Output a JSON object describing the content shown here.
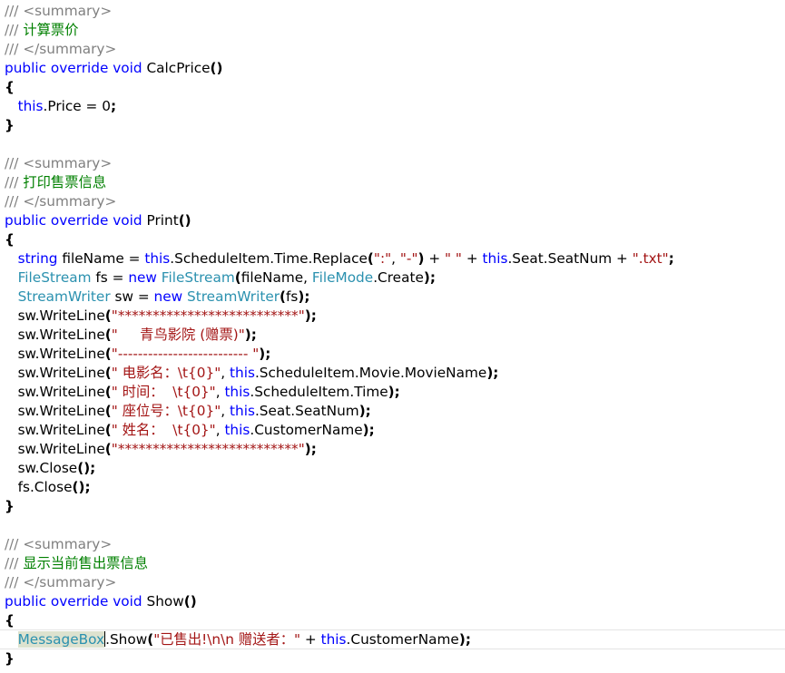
{
  "editor": {
    "current_line": 33,
    "lines": [
      [
        [
          "g",
          "/// <summary>"
        ]
      ],
      [
        [
          "g",
          "/// "
        ],
        [
          "cm",
          "计算票价"
        ]
      ],
      [
        [
          "g",
          "/// </summary>"
        ]
      ],
      [
        [
          "k",
          "public override void "
        ],
        [
          "p",
          "CalcPrice"
        ],
        [
          "b",
          "()"
        ]
      ],
      [
        [
          "b",
          "{"
        ]
      ],
      [
        [
          "p",
          "   "
        ],
        [
          "k",
          "this"
        ],
        [
          "p",
          ".Price = 0"
        ],
        [
          "b",
          ";"
        ]
      ],
      [
        [
          "b",
          "}"
        ]
      ],
      [],
      [
        [
          "g",
          "/// <summary>"
        ]
      ],
      [
        [
          "g",
          "/// "
        ],
        [
          "cm",
          "打印售票信息"
        ]
      ],
      [
        [
          "g",
          "/// </summary>"
        ]
      ],
      [
        [
          "k",
          "public override void "
        ],
        [
          "p",
          "Print"
        ],
        [
          "b",
          "()"
        ]
      ],
      [
        [
          "b",
          "{"
        ]
      ],
      [
        [
          "p",
          "   "
        ],
        [
          "k",
          "string "
        ],
        [
          "p",
          "fileName = "
        ],
        [
          "k",
          "this"
        ],
        [
          "p",
          ".ScheduleItem.Time.Replace"
        ],
        [
          "b",
          "("
        ],
        [
          "s",
          "\":\""
        ],
        [
          "p",
          ", "
        ],
        [
          "s",
          "\"-\""
        ],
        [
          "b",
          ")"
        ],
        [
          "p",
          " + "
        ],
        [
          "s",
          "\" \""
        ],
        [
          "p",
          " + "
        ],
        [
          "k",
          "this"
        ],
        [
          "p",
          ".Seat.SeatNum + "
        ],
        [
          "s",
          "\".txt\""
        ],
        [
          "b",
          ";"
        ]
      ],
      [
        [
          "p",
          "   "
        ],
        [
          "ty",
          "FileStream "
        ],
        [
          "p",
          "fs = "
        ],
        [
          "k",
          "new "
        ],
        [
          "ty",
          "FileStream"
        ],
        [
          "b",
          "("
        ],
        [
          "p",
          "fileName, "
        ],
        [
          "ty",
          "FileMode"
        ],
        [
          "p",
          ".Create"
        ],
        [
          "b",
          ");"
        ]
      ],
      [
        [
          "p",
          "   "
        ],
        [
          "ty",
          "StreamWriter "
        ],
        [
          "p",
          "sw = "
        ],
        [
          "k",
          "new "
        ],
        [
          "ty",
          "StreamWriter"
        ],
        [
          "b",
          "("
        ],
        [
          "p",
          "fs"
        ],
        [
          "b",
          ");"
        ]
      ],
      [
        [
          "p",
          "   sw.WriteLine"
        ],
        [
          "b",
          "("
        ],
        [
          "s",
          "\"**************************\""
        ],
        [
          "b",
          ");"
        ]
      ],
      [
        [
          "p",
          "   sw.WriteLine"
        ],
        [
          "b",
          "("
        ],
        [
          "s",
          "\"     青鸟影院 (赠票)\""
        ],
        [
          "b",
          ");"
        ]
      ],
      [
        [
          "p",
          "   sw.WriteLine"
        ],
        [
          "b",
          "("
        ],
        [
          "s",
          "\"-------------------------- \""
        ],
        [
          "b",
          ");"
        ]
      ],
      [
        [
          "p",
          "   sw.WriteLine"
        ],
        [
          "b",
          "("
        ],
        [
          "s",
          "\" 电影名：\\t{0}\""
        ],
        [
          "p",
          ", "
        ],
        [
          "k",
          "this"
        ],
        [
          "p",
          ".ScheduleItem.Movie.MovieName"
        ],
        [
          "b",
          ");"
        ]
      ],
      [
        [
          "p",
          "   sw.WriteLine"
        ],
        [
          "b",
          "("
        ],
        [
          "s",
          "\" 时间：  \\t{0}\""
        ],
        [
          "p",
          ", "
        ],
        [
          "k",
          "this"
        ],
        [
          "p",
          ".ScheduleItem.Time"
        ],
        [
          "b",
          ");"
        ]
      ],
      [
        [
          "p",
          "   sw.WriteLine"
        ],
        [
          "b",
          "("
        ],
        [
          "s",
          "\" 座位号：\\t{0}\""
        ],
        [
          "p",
          ", "
        ],
        [
          "k",
          "this"
        ],
        [
          "p",
          ".Seat.SeatNum"
        ],
        [
          "b",
          ");"
        ]
      ],
      [
        [
          "p",
          "   sw.WriteLine"
        ],
        [
          "b",
          "("
        ],
        [
          "s",
          "\" 姓名：  \\t{0}\""
        ],
        [
          "p",
          ", "
        ],
        [
          "k",
          "this"
        ],
        [
          "p",
          ".CustomerName"
        ],
        [
          "b",
          ");"
        ]
      ],
      [
        [
          "p",
          "   sw.WriteLine"
        ],
        [
          "b",
          "("
        ],
        [
          "s",
          "\"**************************\""
        ],
        [
          "b",
          ");"
        ]
      ],
      [
        [
          "p",
          "   sw.Close"
        ],
        [
          "b",
          "();"
        ]
      ],
      [
        [
          "p",
          "   fs.Close"
        ],
        [
          "b",
          "();"
        ]
      ],
      [
        [
          "b",
          "}"
        ]
      ],
      [],
      [
        [
          "g",
          "/// <summary>"
        ]
      ],
      [
        [
          "g",
          "/// "
        ],
        [
          "cm",
          "显示当前售出票信息"
        ]
      ],
      [
        [
          "g",
          "/// </summary>"
        ]
      ],
      [
        [
          "k",
          "public override void "
        ],
        [
          "p",
          "Show"
        ],
        [
          "b",
          "()"
        ]
      ],
      [
        [
          "b",
          "{"
        ]
      ],
      [
        [
          "p",
          "   "
        ],
        [
          "ty hl",
          "MessageBox"
        ],
        [
          "caret",
          ""
        ],
        [
          "p",
          ".Show"
        ],
        [
          "b",
          "("
        ],
        [
          "s",
          "\"已售出!\\n\\n 赠送者：\""
        ],
        [
          "p",
          " + "
        ],
        [
          "k",
          "this"
        ],
        [
          "p",
          ".CustomerName"
        ],
        [
          "b",
          ");"
        ]
      ],
      [
        [
          "b",
          "}"
        ]
      ]
    ]
  }
}
